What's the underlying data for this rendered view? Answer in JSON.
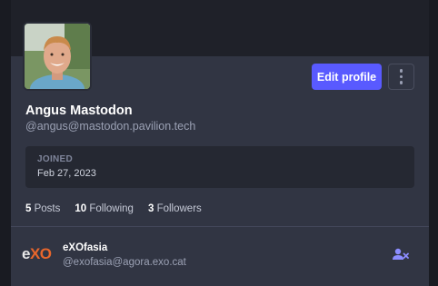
{
  "profile": {
    "display_name": "Angus Mastodon",
    "handle": "@angus@mastodon.pavilion.tech",
    "avatar_icon": "avatar-photo",
    "edit_label": "Edit profile",
    "more_icon": "vertical-ellipsis-icon",
    "joined_label": "JOINED",
    "joined_date": "Feb 27, 2023",
    "stats": {
      "posts_count": "5",
      "posts_label": "Posts",
      "following_count": "10",
      "following_label": "Following",
      "followers_count": "3",
      "followers_label": "Followers"
    }
  },
  "account_list": [
    {
      "logo_e": "e",
      "logo_xo": "XO",
      "name": "eXOfasia",
      "handle": "@exofasia@agora.exo.cat",
      "action_icon": "unfollow-user-icon"
    }
  ],
  "colors": {
    "accent": "#595aff",
    "background": "#191b22",
    "card": "#313543",
    "logo_orange": "#e8662c"
  }
}
